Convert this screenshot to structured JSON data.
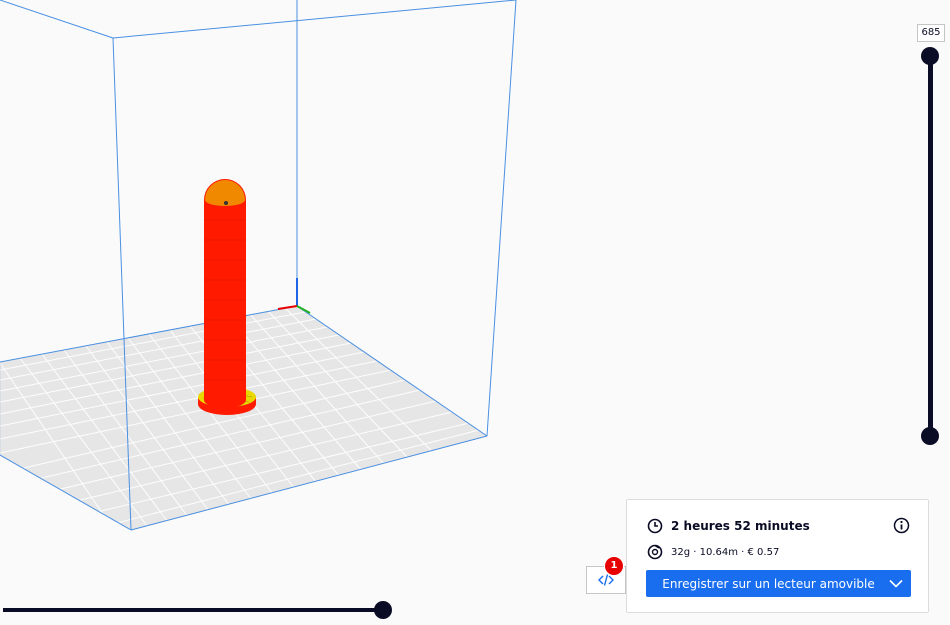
{
  "layer_slider": {
    "value_label": "685",
    "upper_fraction": 1.0,
    "lower_fraction": 0.0
  },
  "path_slider": {
    "fraction": 1.0
  },
  "gcode_button": {
    "icon": "code-icon",
    "badge": "1"
  },
  "print_info": {
    "time": "2 heures 52 minutes",
    "material": "32g · 10.64m · € 0.57",
    "save_button": "Enregistrer sur un lecteur amovible"
  },
  "colors": {
    "accent": "#196ef0",
    "model": "#ff1a00",
    "top_surface": "#e8d800",
    "slider": "#0a0c25",
    "build_volume_lines": "#4a90e2",
    "build_plate": "#e6e6e6",
    "badge": "#e60000"
  }
}
